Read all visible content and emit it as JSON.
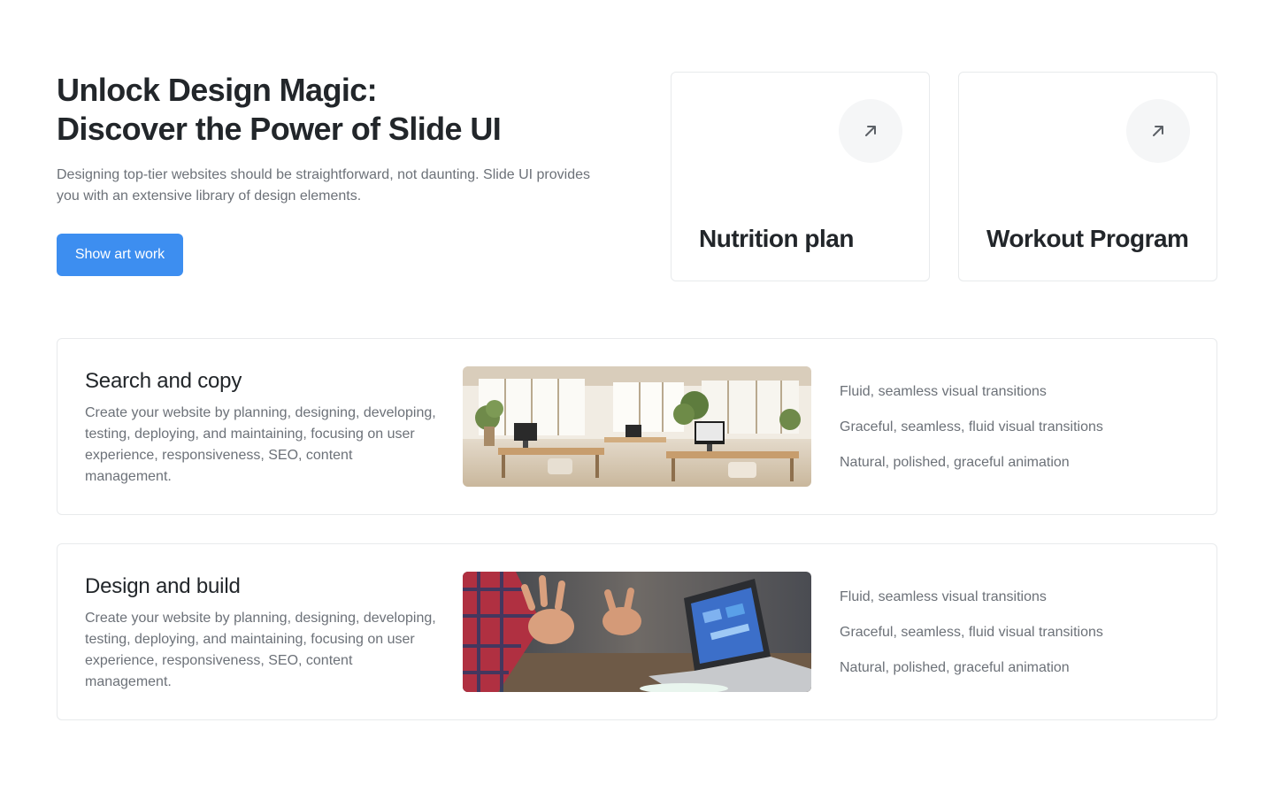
{
  "hero": {
    "title_line1": "Unlock Design Magic:",
    "title_line2": "Discover the Power of Slide UI",
    "description": "Designing top-tier websites should be straightforward, not daunting. Slide UI provides you with an extensive library of design elements.",
    "button_label": "Show art work"
  },
  "tiles": [
    {
      "title": "Nutrition plan",
      "icon": "arrow-up-right-icon"
    },
    {
      "title": "Workout Program",
      "icon": "arrow-up-right-icon"
    }
  ],
  "features": [
    {
      "title": "Search and copy",
      "description": "Create your website by planning, designing, developing, testing, deploying, and maintaining, focusing on user experience, responsiveness, SEO, content management.",
      "image": "office-interior-photo",
      "points": [
        "Fluid, seamless visual transitions",
        "Graceful, seamless, fluid visual transitions",
        "Natural, polished, graceful animation"
      ]
    },
    {
      "title": "Design and build",
      "description": "Create your website by planning, designing, developing, testing, deploying, and maintaining, focusing on user experience, responsiveness, SEO, content management.",
      "image": "laptop-hands-photo",
      "points": [
        "Fluid, seamless visual transitions",
        "Graceful, seamless, fluid visual transitions",
        "Natural, polished, graceful animation"
      ]
    }
  ],
  "colors": {
    "accent": "#3d8ef0",
    "heading": "#22262a",
    "body_text": "#6c7178",
    "border": "#e8eaec",
    "icon_bg": "#f5f6f7"
  }
}
